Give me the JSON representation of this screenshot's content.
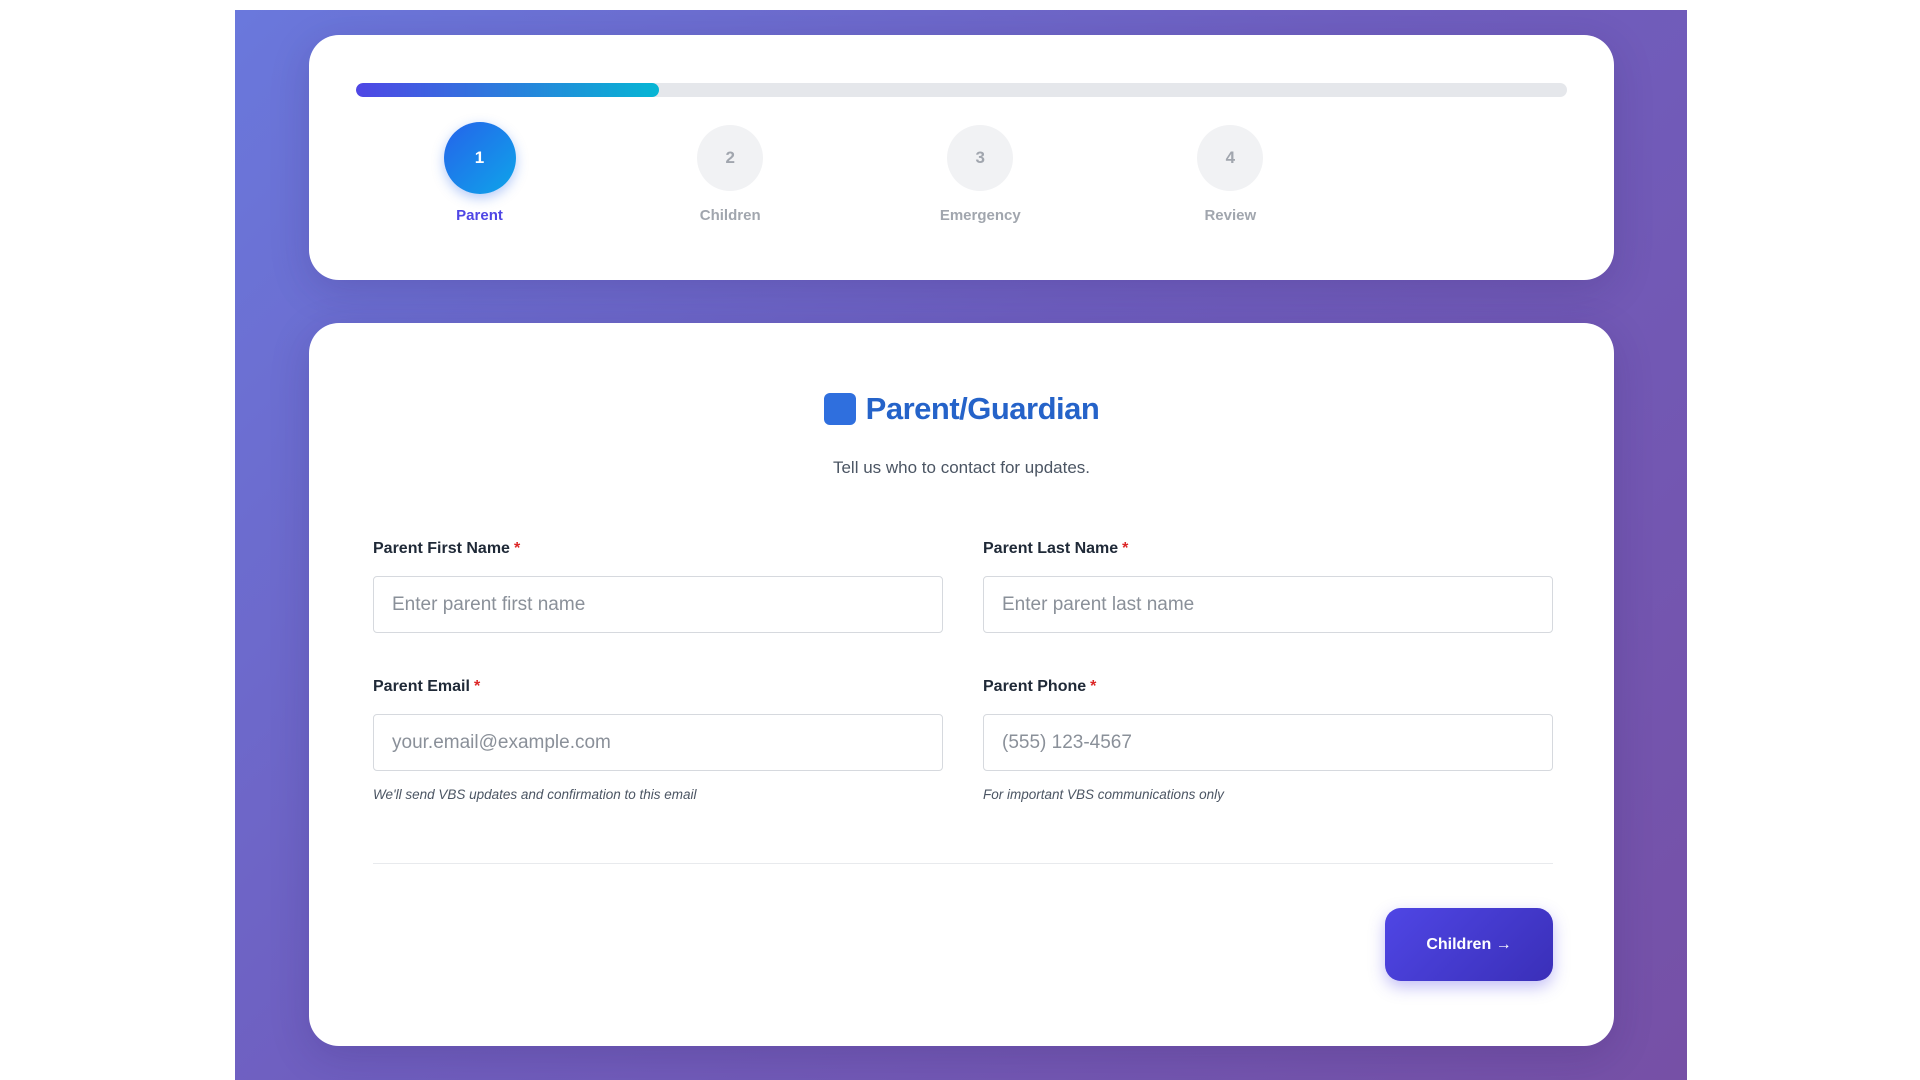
{
  "progress": {
    "percent": 25,
    "steps": [
      {
        "number": "1",
        "label": "Parent",
        "active": true
      },
      {
        "number": "2",
        "label": "Children",
        "active": false
      },
      {
        "number": "3",
        "label": "Emergency",
        "active": false
      },
      {
        "number": "4",
        "label": "Review",
        "active": false
      }
    ]
  },
  "form": {
    "icon": "blue-square-icon",
    "title": "Parent/Guardian",
    "subtitle": "Tell us who to contact for updates.",
    "required_marker": "*",
    "fields": {
      "first_name": {
        "label": "Parent First Name",
        "placeholder": "Enter parent first name",
        "value": ""
      },
      "last_name": {
        "label": "Parent Last Name",
        "placeholder": "Enter parent last name",
        "value": ""
      },
      "email": {
        "label": "Parent Email",
        "placeholder": "your.email@example.com",
        "value": "",
        "hint": "We'll send VBS updates and confirmation to this email"
      },
      "phone": {
        "label": "Parent Phone",
        "placeholder": "(555) 123-4567",
        "value": "",
        "hint": "For important VBS communications only"
      }
    },
    "next_button": "Children →"
  },
  "colors": {
    "accent": "#4f46e5",
    "title": "#2563c9",
    "required": "#dc2626",
    "background_start": "#6a78dc",
    "background_end": "#7650a6"
  }
}
